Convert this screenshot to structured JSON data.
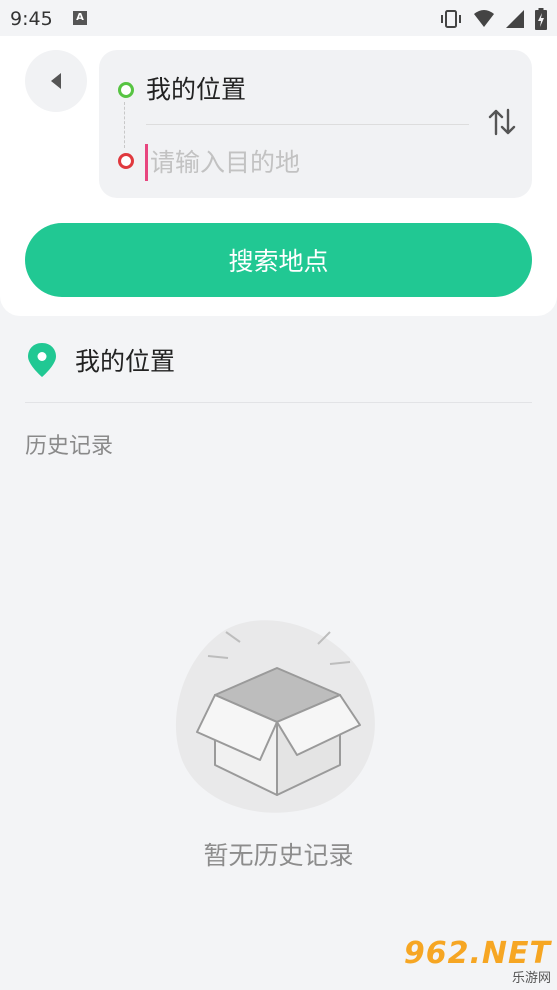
{
  "status_bar": {
    "time": "9:45",
    "notification_icon": "A"
  },
  "route": {
    "origin": "我的位置",
    "destination_placeholder": "请输入目的地",
    "destination_value": ""
  },
  "search_button": {
    "label": "搜索地点"
  },
  "my_location": {
    "label": "我的位置"
  },
  "history": {
    "title": "历史记录",
    "empty_text": "暂无历史记录"
  },
  "watermark": {
    "brand": "962.NET",
    "sub": "乐游网"
  },
  "colors": {
    "accent": "#21c893",
    "start_dot": "#57c442",
    "end_dot": "#e0393e",
    "caret": "#e8467f"
  },
  "icons": [
    "back-arrow-icon",
    "swap-icon",
    "location-pin-icon",
    "empty-box-icon",
    "vibrate-icon",
    "wifi-icon",
    "signal-icon",
    "battery-icon"
  ]
}
